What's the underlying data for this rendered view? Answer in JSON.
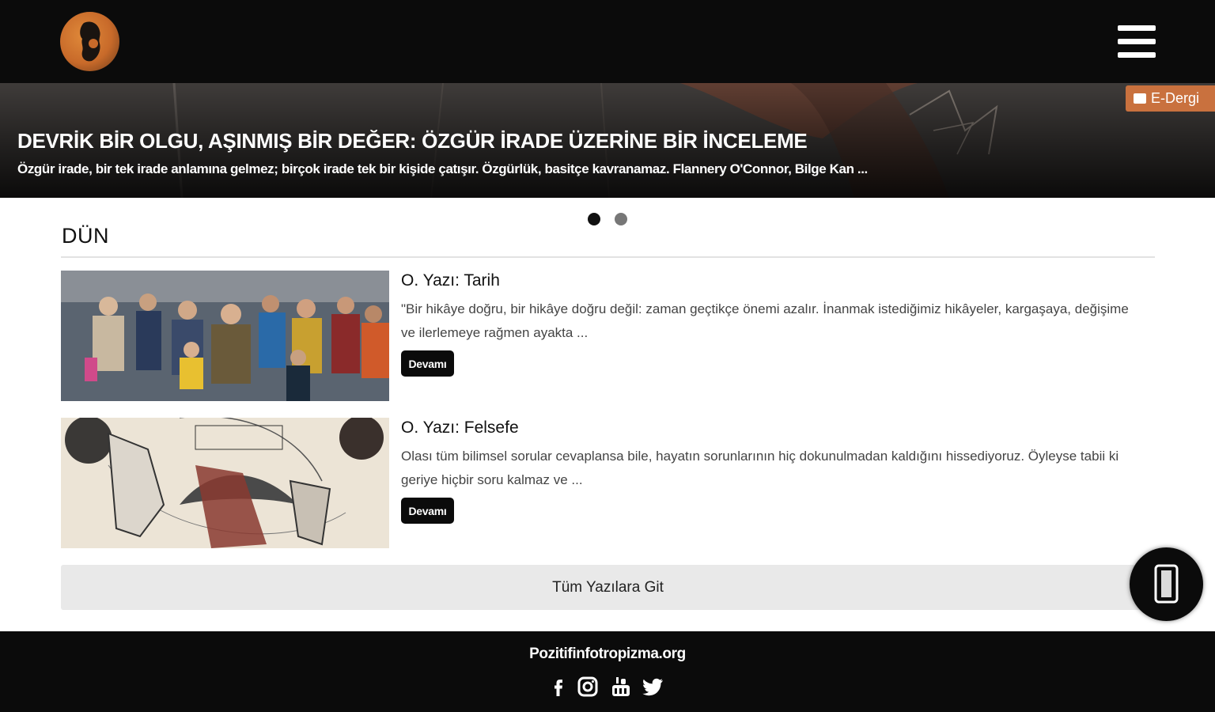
{
  "header": {
    "logo_icon": "logo-emblem",
    "menu_icon": "hamburger-menu-icon"
  },
  "hero": {
    "title": "DEVRİK BİR OLGU, AŞINMIŞ BİR DEĞER: ÖZGÜR İRADE ÜZERİNE BİR İNCELEME",
    "subtitle": "Özgür irade, bir tek irade anlamına gelmez; birçok irade tek bir kişide çatışır. Özgürlük, basitçe kavranamaz. Flannery O'Connor, Bilge Kan ...",
    "badge": "E-Dergi",
    "badge_color": "#c9713e",
    "slides": 2,
    "active_slide": 1
  },
  "section": {
    "title": "DÜN"
  },
  "posts": [
    {
      "title": "O. Yazı: Tarih",
      "excerpt": "\"Bir hikâye doğru, bir hikâye doğru değil: zaman geçtikçe önemi azalır. İnanmak istediğimiz hikâyeler, kargaşaya, değişime ve ilerlemeye rağmen ayakta ...",
      "button": "Devamı"
    },
    {
      "title": "O. Yazı: Felsefe",
      "excerpt": "Olası tüm bilimsel sorular cevaplansa bile, hayatın sorunlarının hiç dokunulmadan kaldığını hissediyoruz. Öyleyse tabii ki geriye hiçbir soru kalmaz ve ...",
      "button": "Devamı"
    }
  ],
  "all_posts_button": "Tüm Yazılara Git",
  "fab_icon": "phone-icon",
  "footer": {
    "site": "Pozitifinfotropizma.org",
    "social": [
      "facebook-icon",
      "instagram-icon",
      "youtube-icon",
      "twitter-icon"
    ]
  }
}
